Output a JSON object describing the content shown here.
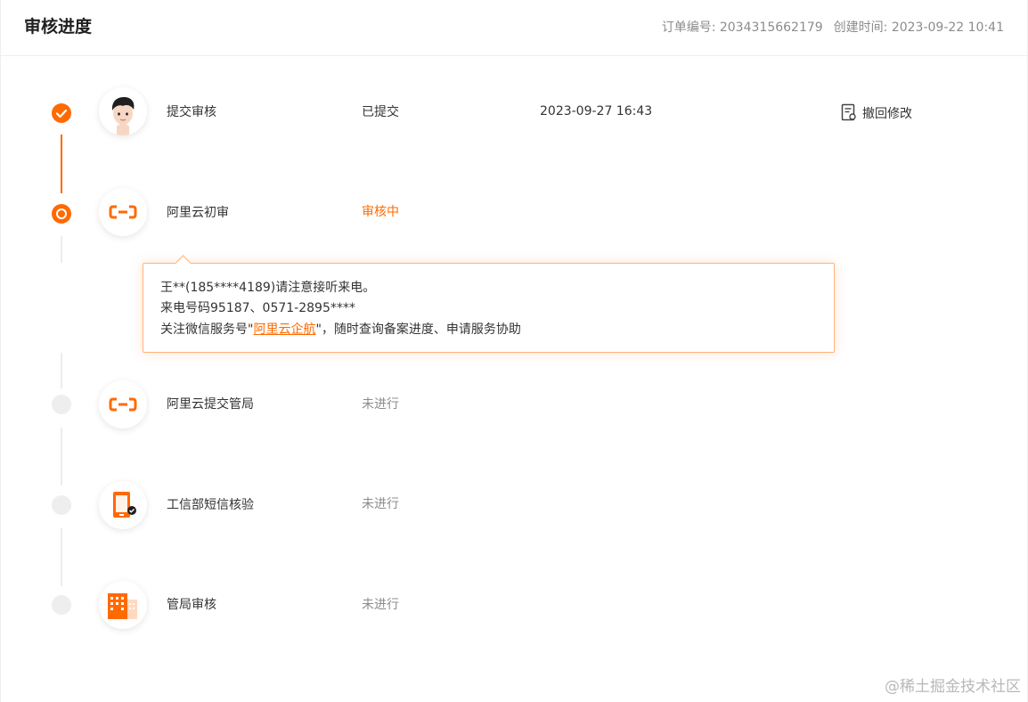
{
  "header": {
    "title": "审核进度",
    "order_label": "订单编号: 2034315662179",
    "created_label": "创建时间: 2023-09-22 10:41"
  },
  "steps": [
    {
      "name": "提交审核",
      "status": "已提交",
      "state": "done",
      "time": "2023-09-27 16:43",
      "action": "撤回修改",
      "icon": "user-avatar-icon"
    },
    {
      "name": "阿里云初审",
      "status": "审核中",
      "state": "active",
      "icon": "aliyun-logo-icon"
    },
    {
      "name": "阿里云提交管局",
      "status": "未进行",
      "state": "todo",
      "icon": "aliyun-logo-icon"
    },
    {
      "name": "工信部短信核验",
      "status": "未进行",
      "state": "todo",
      "icon": "phone-verify-icon"
    },
    {
      "name": "管局审核",
      "status": "未进行",
      "state": "todo",
      "icon": "building-icon"
    }
  ],
  "tip": {
    "line1": "王**(185****4189)请注意接听来电。",
    "line2": "来电号码95187、0571-2895****",
    "line3_prefix": "关注微信服务号\"",
    "line3_link": "阿里云企航",
    "line3_suffix": "\"，随时查询备案进度、申请服务协助"
  },
  "watermark": "@稀土掘金技术社区",
  "colors": {
    "accent": "#ff6a00",
    "pending": "#eeeeee",
    "muted": "#8c8c8c"
  }
}
